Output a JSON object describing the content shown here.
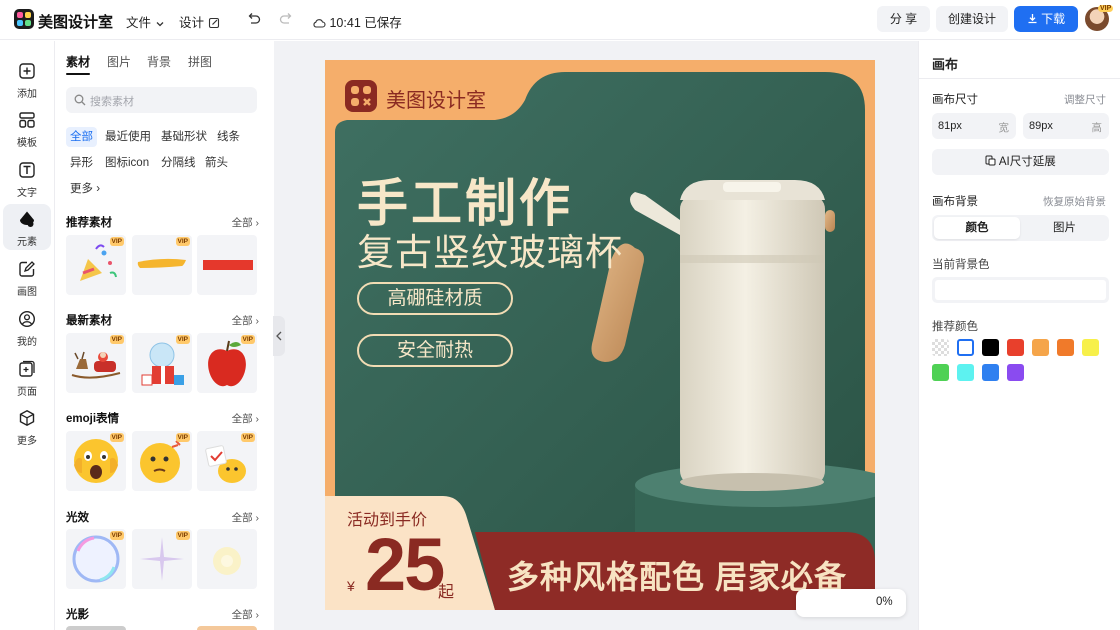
{
  "topbar": {
    "brand": "美图设计室",
    "menu_file": "文件",
    "menu_design": "设计",
    "save_status": "10:41 已保存",
    "share_label": "分 享",
    "create_label": "创建设计",
    "download_label": "下载",
    "vip_badge": "VIP"
  },
  "rail": [
    {
      "label": "添加",
      "icon": "plus-square-icon"
    },
    {
      "label": "模板",
      "icon": "template-icon"
    },
    {
      "label": "文字",
      "icon": "text-icon"
    },
    {
      "label": "元素",
      "icon": "shapes-icon"
    },
    {
      "label": "画图",
      "icon": "draw-icon"
    },
    {
      "label": "我的",
      "icon": "user-icon"
    },
    {
      "label": "页面",
      "icon": "page-add-icon"
    },
    {
      "label": "更多",
      "icon": "cube-icon"
    }
  ],
  "panel": {
    "tabs": [
      "素材",
      "图片",
      "背景",
      "拼图"
    ],
    "search_placeholder": "搜索素材",
    "chips": [
      "全部",
      "最近使用",
      "基础形状",
      "线条",
      "异形",
      "图标icon",
      "分隔线",
      "箭头",
      "更多"
    ],
    "sections": [
      {
        "title": "推荐素材",
        "all": "全部"
      },
      {
        "title": "最新素材",
        "all": "全部"
      },
      {
        "title": "emoji表情",
        "all": "全部"
      },
      {
        "title": "光效",
        "all": "全部"
      },
      {
        "title": "光影",
        "all": "全部"
      }
    ],
    "vip": "VIP"
  },
  "canvas": {
    "brand": "美图设计室",
    "headline1": "手工制作",
    "headline2": "复古竖纹玻璃杯",
    "badge1": "高硼硅材质",
    "badge2": "安全耐热",
    "price_label": "活动到手价",
    "currency": "¥",
    "price": "25",
    "price_suffix": "起",
    "banner": "多种风格配色 居家必备"
  },
  "zoom": {
    "value": "0%"
  },
  "right": {
    "title": "画布",
    "size_label": "画布尺寸",
    "size_adjust": "调整尺寸",
    "width_value": "81px",
    "width_unit": "宽",
    "height_value": "89px",
    "height_unit": "高",
    "ai_extend": "AI尺寸延展",
    "bg_label": "画布背景",
    "bg_restore": "恢复原始背景",
    "seg_color": "颜色",
    "seg_image": "图片",
    "current_bg": "当前背景色",
    "recommend": "推荐颜色",
    "colors": [
      "transparent",
      "#ffffff",
      "#000000",
      "#e8402c",
      "#f5a54a",
      "#f07a2a",
      "#f7f04a",
      "#4fd155",
      "#5df2f0",
      "#2f80f0",
      "#8a4bf0"
    ]
  }
}
